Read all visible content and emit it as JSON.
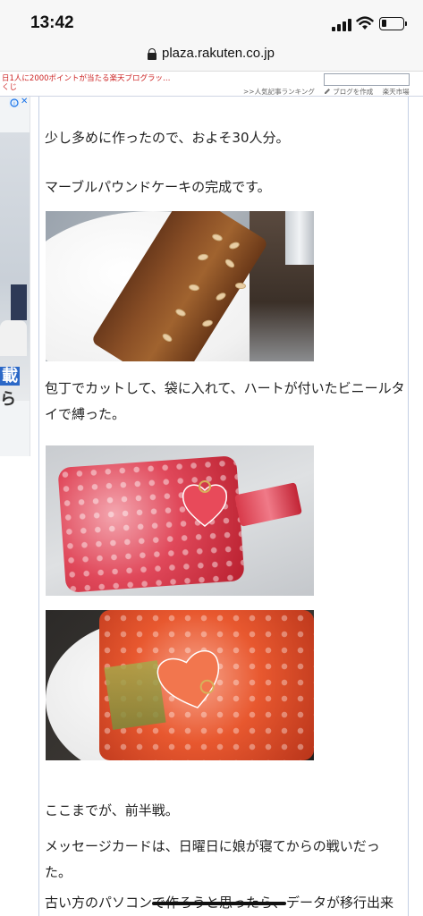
{
  "status_bar": {
    "time": "13:42",
    "signal_bars": 4,
    "battery_level": 0.25
  },
  "browser": {
    "url": "plaza.rakuten.co.jp"
  },
  "blog_header": {
    "promo_text": "日1人に2000ポイントが当たる楽天ブログラッ…くじ",
    "nav": {
      "ranking": ">>人気記事ランキング",
      "create_blog": "ブログを作成",
      "market": "楽天市場"
    }
  },
  "ad": {
    "choices_icon": "ad-choices-icon",
    "close_label": "✕",
    "text_line1": "載",
    "text_line2": "ら"
  },
  "article": {
    "para1": "少し多めに作ったので、およそ30人分。",
    "para2": "マーブルパウンドケーキの完成です。",
    "para3": "包丁でカットして、袋に入れて、ハートが付いたビニールタイで縛った。",
    "para4": "ここまでが、前半戦。",
    "para5": "メッセージカードは、日曜日に娘が寝てからの戦いだった。",
    "para6": "古い方のパソコンで作ろうと思ったら、データが移行出来"
  },
  "colors": {
    "accent_red": "#cc2222",
    "column_border": "#c4cfe4",
    "ad_blue": "#2b68c7"
  }
}
